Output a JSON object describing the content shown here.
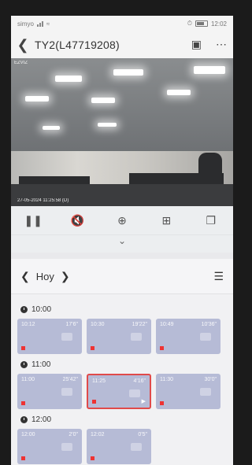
{
  "statusbar": {
    "carrier": "simyo",
    "time": "12:02"
  },
  "header": {
    "title": "TY2(L47719208)"
  },
  "video": {
    "watermark": "EZVIZ",
    "timestamp": "27-05-2024 11:25:58 (D)"
  },
  "daybar": {
    "day_label": "Hoy"
  },
  "timeline": {
    "groups": [
      {
        "hour": "10:00",
        "clips": [
          {
            "time": "10:12",
            "duration": "17'6\""
          },
          {
            "time": "10:30",
            "duration": "19'22\""
          },
          {
            "time": "10:49",
            "duration": "10'36\""
          }
        ]
      },
      {
        "hour": "11:00",
        "clips": [
          {
            "time": "11:00",
            "duration": "25'42\""
          },
          {
            "time": "11:25",
            "duration": "4'16\"",
            "selected": true
          },
          {
            "time": "11:30",
            "duration": "30'0\""
          }
        ]
      },
      {
        "hour": "12:00",
        "clips": [
          {
            "time": "12:00",
            "duration": "2'0\""
          },
          {
            "time": "12:02",
            "duration": "0'5\""
          }
        ]
      }
    ]
  },
  "colors": {
    "clip": "#b6bbd6",
    "selected_border": "#e04a4a",
    "record_mark": "#e33333"
  }
}
